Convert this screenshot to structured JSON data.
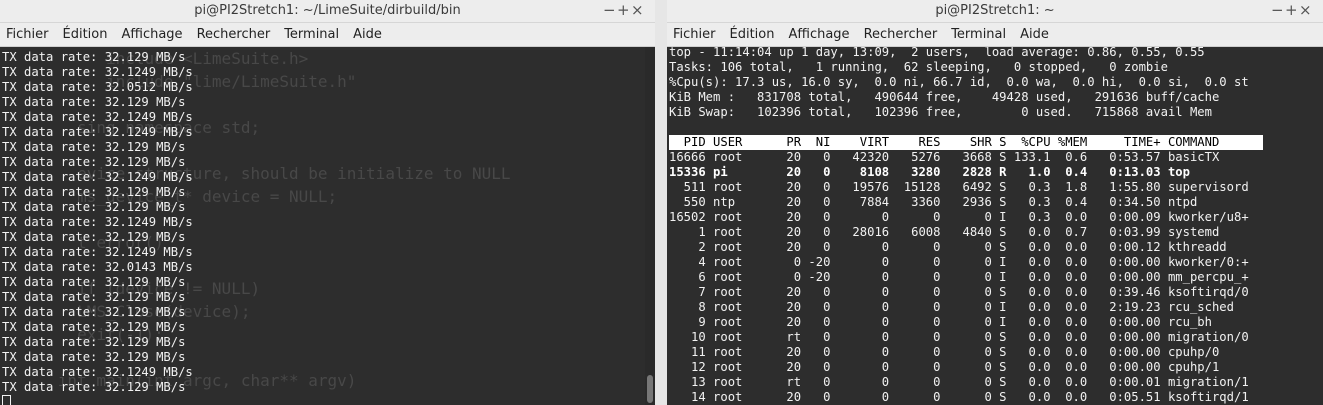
{
  "left_window": {
    "title": "pi@PI2Stretch1: ~/LimeSuite/dirbuild/bin",
    "controls": [
      "−",
      "+",
      "×"
    ],
    "menu": [
      "Fichier",
      "Édition",
      "Affichage",
      "Rechercher",
      "Terminal",
      "Aide"
    ],
    "background_code": [
      "           include <LimeSuite.h>",
      "           include \"lime/LimeSuite.h\"",
      "",
      "        sing namespace std;",
      "",
      "        evice structure, should be initialize to NULL",
      "        ms_device_t* device = NULL;",
      "",
      "        t error()",
      "",
      "        if (device != NULL)",
      "        LMS_Close(device);",
      "        exit(-1);",
      "",
      "      int main(int argc, char** argv)"
    ],
    "tx_lines": [
      "TX data rate: 32.129 MB/s",
      "TX data rate: 32.1249 MB/s",
      "TX data rate: 32.0512 MB/s",
      "TX data rate: 32.129 MB/s",
      "TX data rate: 32.1249 MB/s",
      "TX data rate: 32.1249 MB/s",
      "TX data rate: 32.129 MB/s",
      "TX data rate: 32.129 MB/s",
      "TX data rate: 32.1249 MB/s",
      "TX data rate: 32.129 MB/s",
      "TX data rate: 32.129 MB/s",
      "TX data rate: 32.1249 MB/s",
      "TX data rate: 32.129 MB/s",
      "TX data rate: 32.1249 MB/s",
      "TX data rate: 32.0143 MB/s",
      "TX data rate: 32.129 MB/s",
      "TX data rate: 32.129 MB/s",
      "TX data rate: 32.129 MB/s",
      "TX data rate: 32.129 MB/s",
      "TX data rate: 32.129 MB/s",
      "TX data rate: 32.129 MB/s",
      "TX data rate: 32.1249 MB/s",
      "TX data rate: 32.129 MB/s"
    ]
  },
  "right_window": {
    "title": "pi@PI2Stretch1: ~",
    "controls": [
      "−",
      "+",
      "×"
    ],
    "menu": [
      "Fichier",
      "Édition",
      "Affichage",
      "Rechercher",
      "Terminal",
      "Aide"
    ],
    "summary": [
      "top - 11:14:04 up 1 day, 13:09,  2 users,  load average: 0.86, 0.55, 0.55",
      "Tasks: 106 total,   1 running,  62 sleeping,   0 stopped,   0 zombie",
      "%Cpu(s): 17.3 us, 16.0 sy,  0.0 ni, 66.7 id,  0.0 wa,  0.0 hi,  0.0 si,  0.0 st",
      "KiB Mem :   831708 total,   490644 free,    49428 used,   291636 buff/cache",
      "KiB Swap:   102396 total,   102396 free,        0 used.   715868 avail Mem",
      ""
    ],
    "table_header": "  PID USER      PR  NI    VIRT    RES    SHR S  %CPU %MEM     TIME+ COMMAND      ",
    "rows": [
      {
        "text": "16666 root      20   0   42320   5276   3668 S 133.1  0.6   0:53.57 basicTX",
        "bold": false
      },
      {
        "text": "15336 pi        20   0    8108   3280   2828 R   1.0  0.4   0:13.03 top",
        "bold": true
      },
      {
        "text": "  511 root      20   0   19576  15128   6492 S   0.3  1.8   1:55.80 supervisord",
        "bold": false
      },
      {
        "text": "  550 ntp       20   0    7884   3360   2936 S   0.3  0.4   0:34.50 ntpd",
        "bold": false
      },
      {
        "text": "16502 root      20   0       0      0      0 I   0.3  0.0   0:00.09 kworker/u8+",
        "bold": false
      },
      {
        "text": "    1 root      20   0   28016   6008   4840 S   0.0  0.7   0:03.99 systemd",
        "bold": false
      },
      {
        "text": "    2 root      20   0       0      0      0 S   0.0  0.0   0:00.12 kthreadd",
        "bold": false
      },
      {
        "text": "    4 root       0 -20       0      0      0 I   0.0  0.0   0:00.00 kworker/0:+",
        "bold": false
      },
      {
        "text": "    6 root       0 -20       0      0      0 I   0.0  0.0   0:00.00 mm_percpu_+",
        "bold": false
      },
      {
        "text": "    7 root      20   0       0      0      0 S   0.0  0.0   0:39.46 ksoftirqd/0",
        "bold": false
      },
      {
        "text": "    8 root      20   0       0      0      0 I   0.0  0.0   2:19.23 rcu_sched",
        "bold": false
      },
      {
        "text": "    9 root      20   0       0      0      0 I   0.0  0.0   0:00.00 rcu_bh",
        "bold": false
      },
      {
        "text": "   10 root      rt   0       0      0      0 S   0.0  0.0   0:00.00 migration/0",
        "bold": false
      },
      {
        "text": "   11 root      20   0       0      0      0 S   0.0  0.0   0:00.00 cpuhp/0",
        "bold": false
      },
      {
        "text": "   12 root      20   0       0      0      0 S   0.0  0.0   0:00.00 cpuhp/1",
        "bold": false
      },
      {
        "text": "   13 root      rt   0       0      0      0 S   0.0  0.0   0:00.01 migration/1",
        "bold": false
      },
      {
        "text": "   14 root      20   0       0      0      0 S   0.0  0.0   0:05.51 ksoftirqd/1",
        "bold": false
      }
    ]
  }
}
